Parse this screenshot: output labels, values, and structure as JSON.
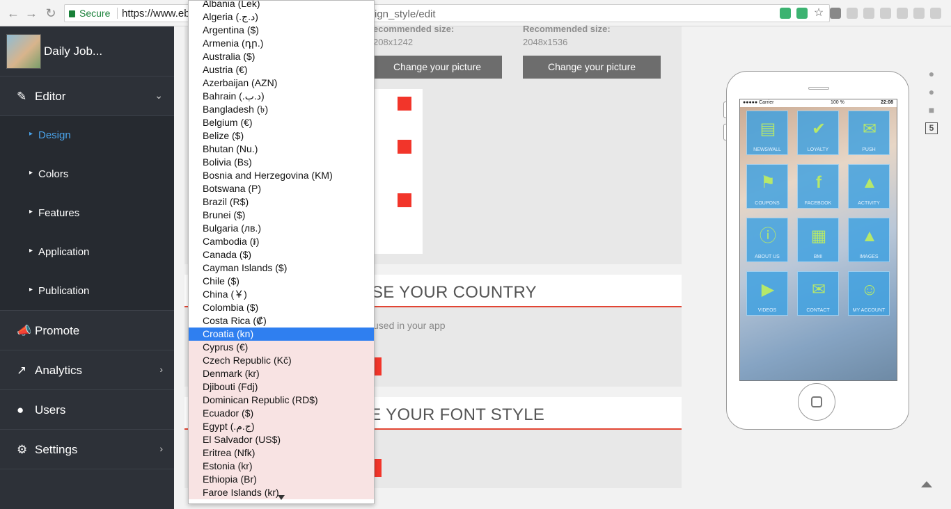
{
  "browser": {
    "secure_label": "Secure",
    "url_visible_start": "https://www.eb",
    "url_visible_end": "ign_style/edit",
    "back_icon": "arrow-left-icon",
    "forward_icon": "arrow-right-icon",
    "reload_icon": "reload-icon"
  },
  "sidebar": {
    "brand": "Daily Job...",
    "menu": [
      {
        "label": "Editor",
        "icon": "pencil-icon",
        "chevron": "chevron-down-icon"
      },
      {
        "label": "Promote",
        "icon": "megaphone-icon"
      },
      {
        "label": "Analytics",
        "icon": "chart-line-icon",
        "chevron": "chevron-right-icon"
      },
      {
        "label": "Users",
        "icon": "users-icon"
      },
      {
        "label": "Settings",
        "icon": "gears-icon",
        "chevron": "chevron-right-icon"
      }
    ],
    "submenu": [
      {
        "label": "Design",
        "active": true
      },
      {
        "label": "Colors"
      },
      {
        "label": "Features"
      },
      {
        "label": "Application"
      },
      {
        "label": "Publication"
      }
    ]
  },
  "main": {
    "rec_label_1": "ecommended size:",
    "rec_size_1": "208x1242",
    "rec_label_2": "Recommended size:",
    "rec_size_2": "2048x1536",
    "change_picture_1": "Change your picture",
    "change_picture_2": "Change your picture",
    "country_title": "OSE YOUR COUNTRY",
    "country_desc": "used in your app",
    "font_title": "SE YOUR FONT STYLE"
  },
  "phone": {
    "carrier": "●●●●● Carrier",
    "battery": "100 %",
    "time": "22:08",
    "tiles": [
      {
        "label": "NEWSWALL",
        "icon": "newspaper-icon"
      },
      {
        "label": "LOYALTY",
        "icon": "shield-check-icon"
      },
      {
        "label": "PUSH",
        "icon": "push-icon"
      },
      {
        "label": "COUPONS",
        "icon": "tag-icon"
      },
      {
        "label": "FACEBOOK",
        "icon": "facebook-icon"
      },
      {
        "label": "ACTIVITY",
        "icon": "activity-icon"
      },
      {
        "label": "ABOUT US",
        "icon": "info-icon"
      },
      {
        "label": "BMI",
        "icon": "calculator-icon"
      },
      {
        "label": "IMAGES",
        "icon": "image-icon"
      },
      {
        "label": "VIDEOS",
        "icon": "play-icon"
      },
      {
        "label": "CONTACT",
        "icon": "envelope-icon"
      },
      {
        "label": "MY ACCOUNT",
        "icon": "account-icon"
      }
    ]
  },
  "os_icons": [
    "apple-icon",
    "apple-icon",
    "android-icon",
    "html5-icon"
  ],
  "dropdown": {
    "selected": "Croatia (kn)",
    "options": [
      "Albania (Lek)",
      "Algeria (.د.ج)",
      "Argentina ($)",
      "Armenia (դր.)",
      "Australia ($)",
      "Austria (€)",
      "Azerbaijan (AZN)",
      "Bahrain (.د.ب)",
      "Bangladesh (৳)",
      "Belgium (€)",
      "Belize ($)",
      "Bhutan (Nu.)",
      "Bolivia (Bs)",
      "Bosnia and Herzegovina (KM)",
      "Botswana (P)",
      "Brazil (R$)",
      "Brunei ($)",
      "Bulgaria (лв.)",
      "Cambodia (៛)",
      "Canada ($)",
      "Cayman Islands ($)",
      "Chile ($)",
      "China (￥)",
      "Colombia ($)",
      "Costa Rica (₡)",
      "Croatia (kn)",
      "Cyprus (€)",
      "Czech Republic (Kč)",
      "Denmark (kr)",
      "Djibouti (Fdj)",
      "Dominican Republic (RD$)",
      "Ecuador ($)",
      "Egypt (.ج.م)",
      "El Salvador (US$)",
      "Eritrea (Nfk)",
      "Estonia (kr)",
      "Ethiopia (Br)",
      "Faroe Islands (kr)"
    ]
  }
}
